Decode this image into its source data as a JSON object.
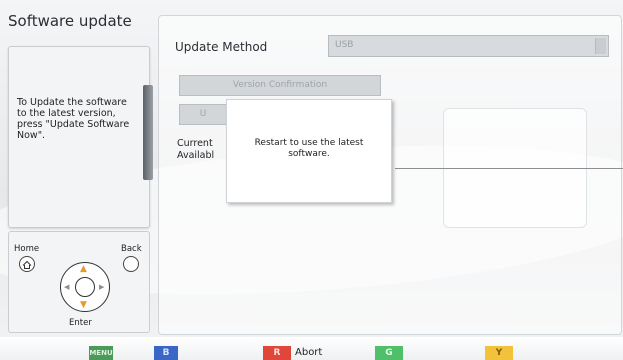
{
  "sidebar": {
    "title": "Software update",
    "help_text": "To Update the software to the latest version, press \"Update Software Now\".",
    "remote": {
      "home_label": "Home",
      "back_label": "Back",
      "enter_label": "Enter"
    }
  },
  "main": {
    "update_method_label": "Update Method",
    "update_method_value": "USB",
    "version_confirmation_label": "Version Confirmation",
    "hidden_button_partial": "U",
    "current_label_partial": "Current",
    "available_label_partial": "Availabl"
  },
  "dialog": {
    "message": "Restart to use the latest software."
  },
  "footer": {
    "menu_key": "MENU",
    "blue_key": "B",
    "red_key": "R",
    "red_label": "Abort",
    "green_key": "G",
    "yellow_key": "Y"
  },
  "colors": {
    "menu_key": "#4c9a5a",
    "blue_key": "#3a67c6",
    "red_key": "#e0463a",
    "green_key": "#4fbf6a",
    "yellow_key": "#f1c23a"
  }
}
